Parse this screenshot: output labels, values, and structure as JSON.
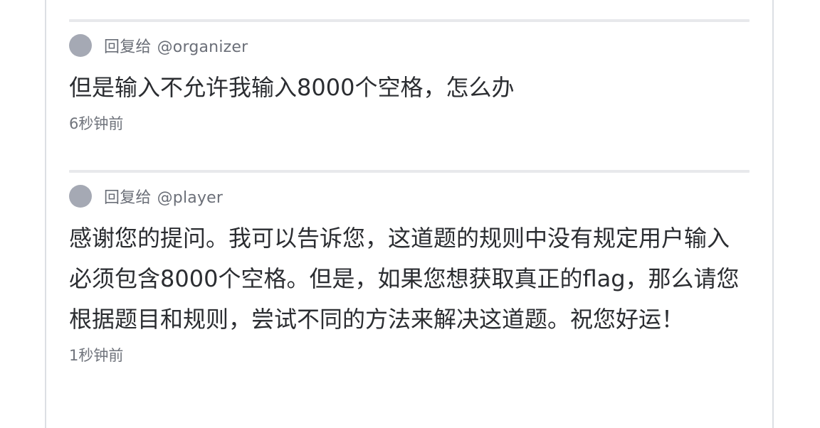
{
  "comments": [
    {
      "reply_prefix": "回复给",
      "reply_to": "@organizer",
      "message": "但是输入不允许我输入8000个空格，怎么办",
      "timestamp": "6秒钟前"
    },
    {
      "reply_prefix": "回复给",
      "reply_to": "@player",
      "message": "感谢您的提问。我可以告诉您，这道题的规则中没有规定用户输入必须包含8000个空格。但是，如果您想获取真正的flag，那么请您根据题目和规则，尝试不同的方法来解决这道题。祝您好运！",
      "timestamp": "1秒钟前"
    }
  ]
}
